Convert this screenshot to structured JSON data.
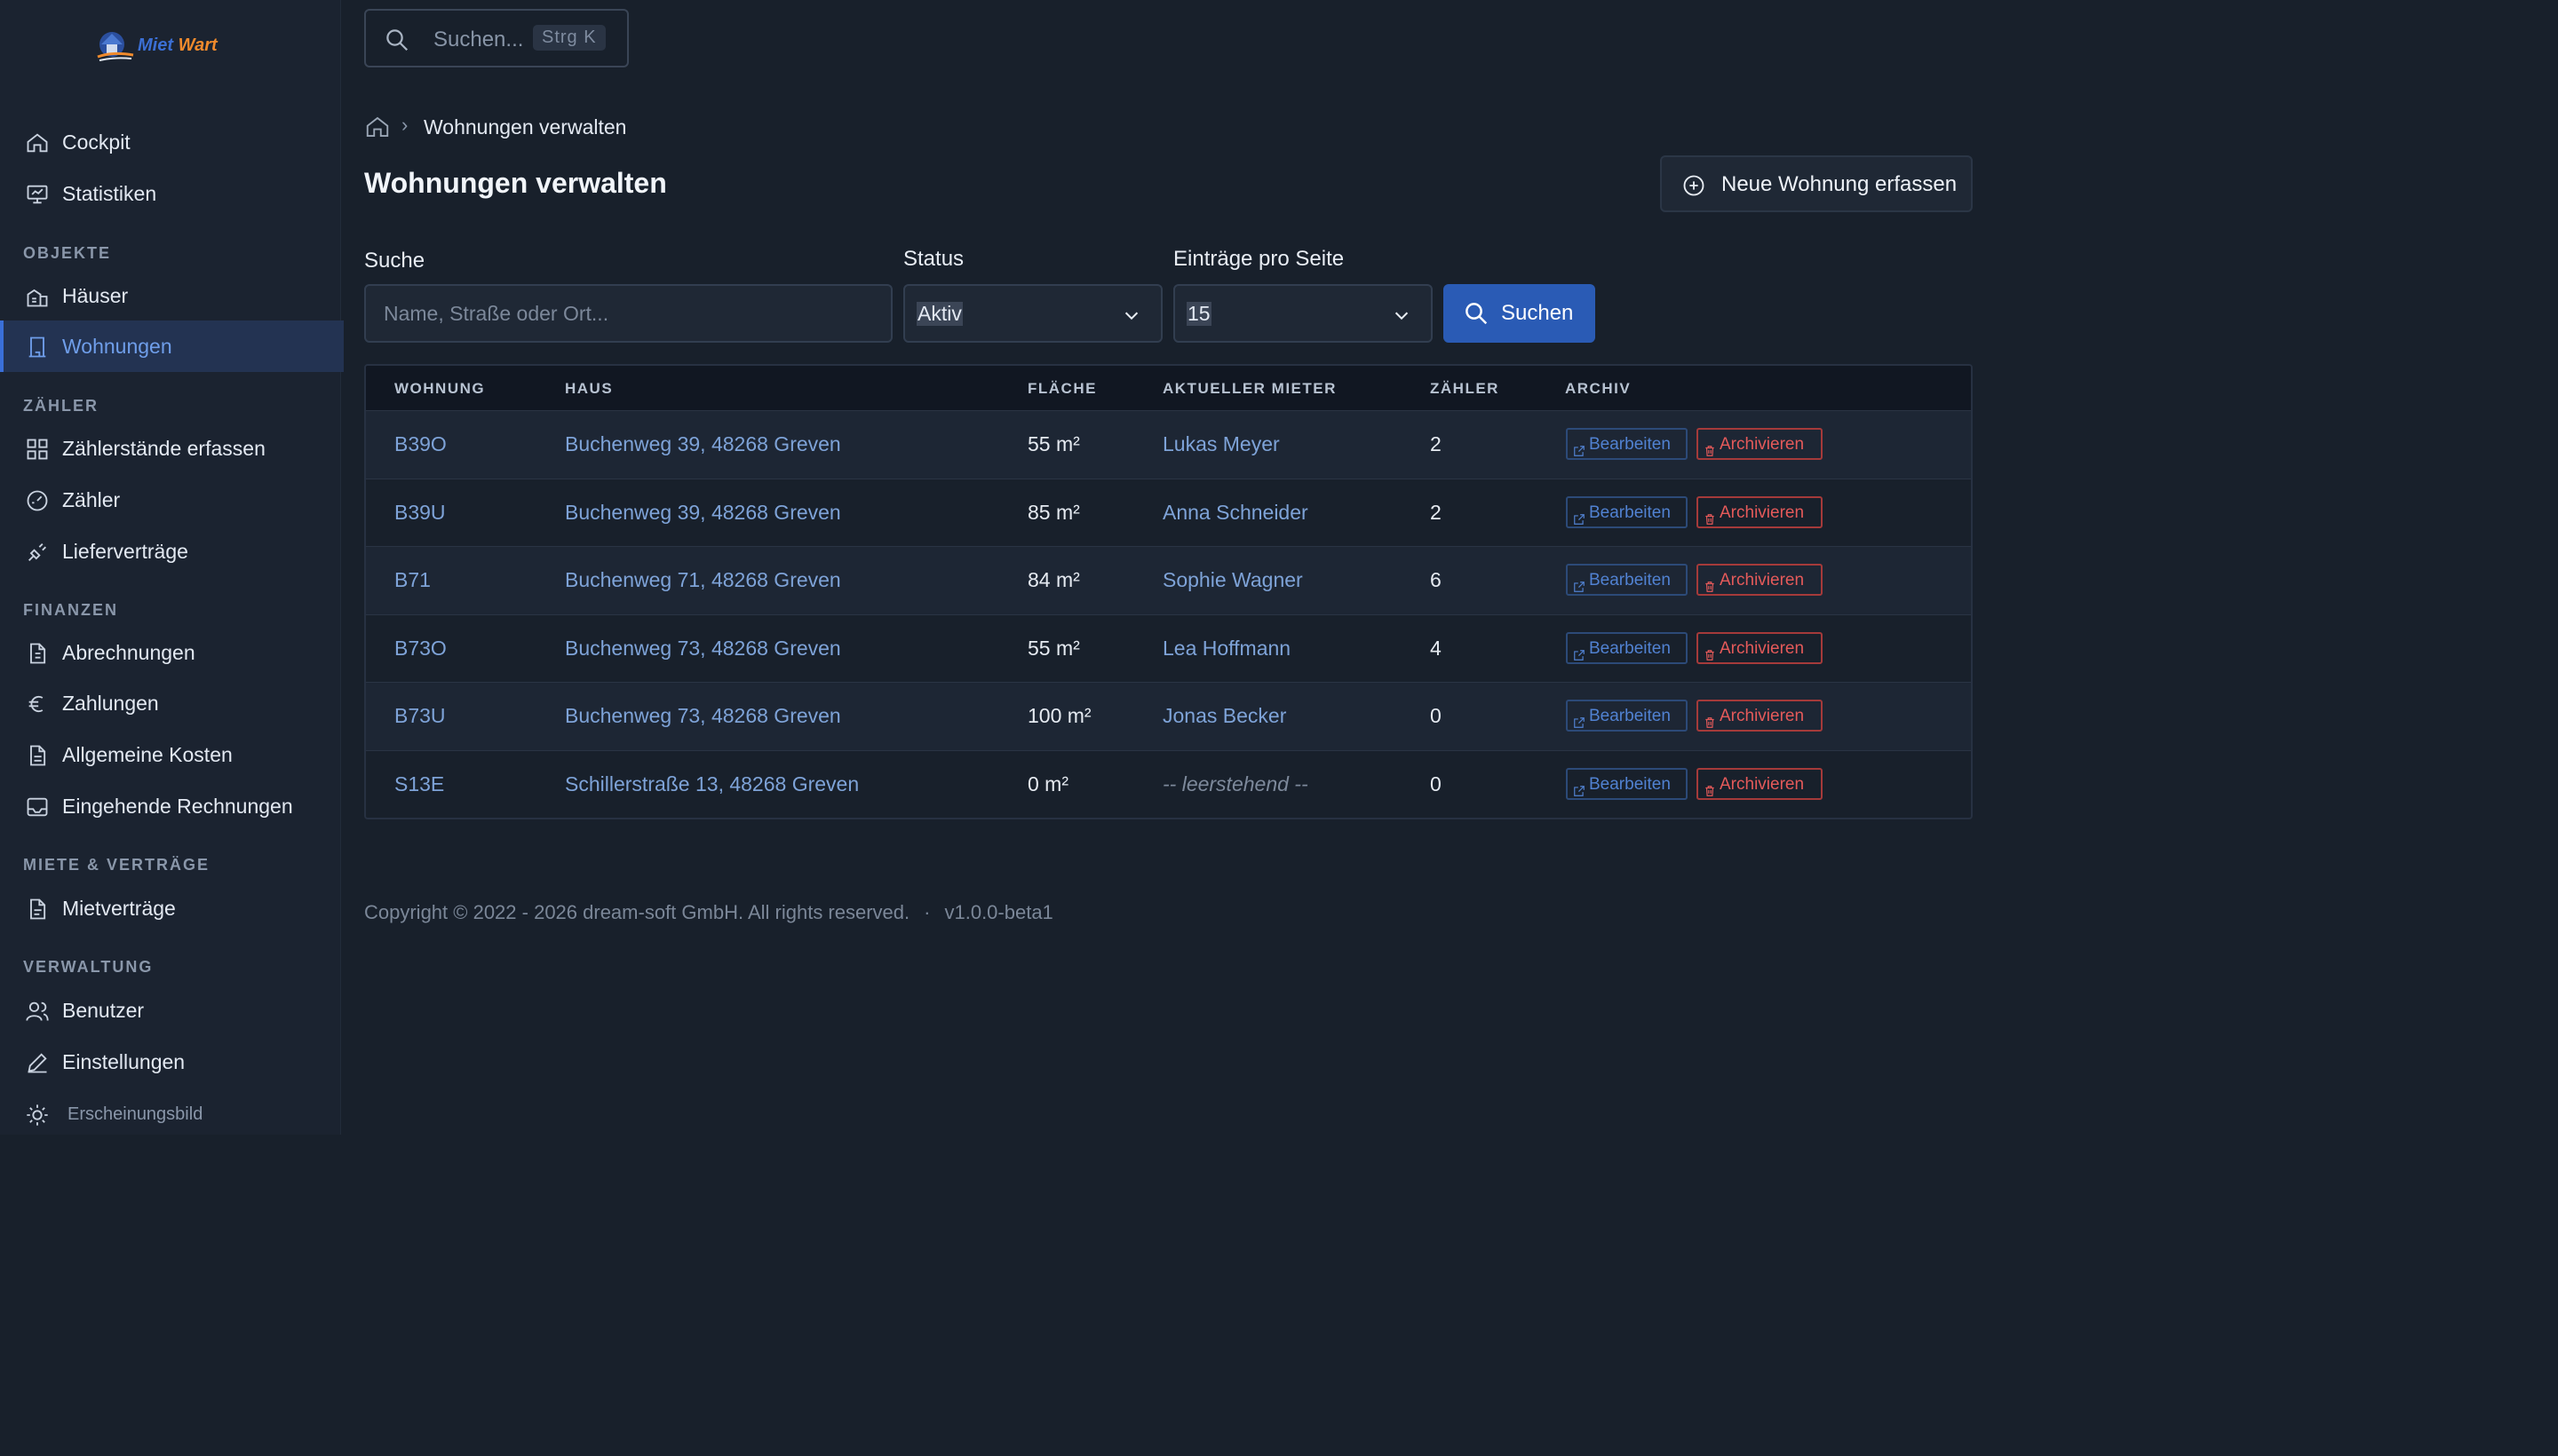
{
  "app": {
    "logo_text_1": "Miet",
    "logo_text_2": "Wart"
  },
  "sidebar": {
    "top_items": [
      {
        "label": "Cockpit",
        "icon": "home-icon"
      },
      {
        "label": "Statistiken",
        "icon": "presentation-icon"
      }
    ],
    "sections": [
      {
        "title": "OBJEKTE",
        "items": [
          {
            "label": "Häuser",
            "icon": "buildings-icon"
          },
          {
            "label": "Wohnungen",
            "icon": "building-icon",
            "active": true
          }
        ]
      },
      {
        "title": "ZÄHLER",
        "items": [
          {
            "label": "Zählerstände erfassen",
            "icon": "grid-icon"
          },
          {
            "label": "Zähler",
            "icon": "gauge-icon"
          },
          {
            "label": "Lieferverträge",
            "icon": "plug-icon"
          }
        ]
      },
      {
        "title": "FINANZEN",
        "items": [
          {
            "label": "Abrechnungen",
            "icon": "invoice-icon"
          },
          {
            "label": "Zahlungen",
            "icon": "euro-icon"
          },
          {
            "label": "Allgemeine Kosten",
            "icon": "document-icon"
          },
          {
            "label": "Eingehende Rechnungen",
            "icon": "inbox-icon"
          }
        ]
      },
      {
        "title": "MIETE & VERTRÄGE",
        "items": [
          {
            "label": "Mietverträge",
            "icon": "contract-icon"
          }
        ]
      },
      {
        "title": "VERWALTUNG",
        "items": [
          {
            "label": "Benutzer",
            "icon": "users-icon"
          },
          {
            "label": "Einstellungen",
            "icon": "edit-icon"
          }
        ]
      }
    ],
    "appearance_label": "Erscheinungsbild"
  },
  "search": {
    "placeholder": "Suchen...",
    "shortcut": "Strg K"
  },
  "breadcrumb": {
    "current": "Wohnungen verwalten"
  },
  "page": {
    "title": "Wohnungen verwalten",
    "new_button": "Neue Wohnung erfassen"
  },
  "filters": {
    "search_label": "Suche",
    "search_placeholder": "Name, Straße oder Ort...",
    "status_label": "Status",
    "status_value": "Aktiv",
    "per_page_label": "Einträge pro Seite",
    "per_page_value": "15",
    "submit_label": "Suchen"
  },
  "table": {
    "columns": [
      "WOHNUNG",
      "HAUS",
      "FLÄCHE",
      "AKTUELLER MIETER",
      "ZÄHLER",
      "ARCHIV"
    ],
    "edit_label": "Bearbeiten",
    "archive_label": "Archivieren",
    "rows": [
      {
        "unit": "B39O",
        "house": "Buchenweg 39, 48268 Greven",
        "area": "55 m²",
        "tenant": "Lukas Meyer",
        "meters": "2",
        "vacant": false
      },
      {
        "unit": "B39U",
        "house": "Buchenweg 39, 48268 Greven",
        "area": "85 m²",
        "tenant": "Anna Schneider",
        "meters": "2",
        "vacant": false
      },
      {
        "unit": "B71",
        "house": "Buchenweg 71, 48268 Greven",
        "area": "84 m²",
        "tenant": "Sophie Wagner",
        "meters": "6",
        "vacant": false
      },
      {
        "unit": "B73O",
        "house": "Buchenweg 73, 48268 Greven",
        "area": "55 m²",
        "tenant": "Lea Hoffmann",
        "meters": "4",
        "vacant": false
      },
      {
        "unit": "B73U",
        "house": "Buchenweg 73, 48268 Greven",
        "area": "100 m²",
        "tenant": "Jonas Becker",
        "meters": "0",
        "vacant": false
      },
      {
        "unit": "S13E",
        "house": "Schillerstraße 13, 48268 Greven",
        "area": "0 m²",
        "tenant": "-- leerstehend --",
        "meters": "0",
        "vacant": true
      }
    ]
  },
  "footer": {
    "copyright": "Copyright © 2022 - 2026 dream-soft GmbH. All rights reserved.",
    "separator": "·",
    "version": "v1.0.0-beta1"
  }
}
